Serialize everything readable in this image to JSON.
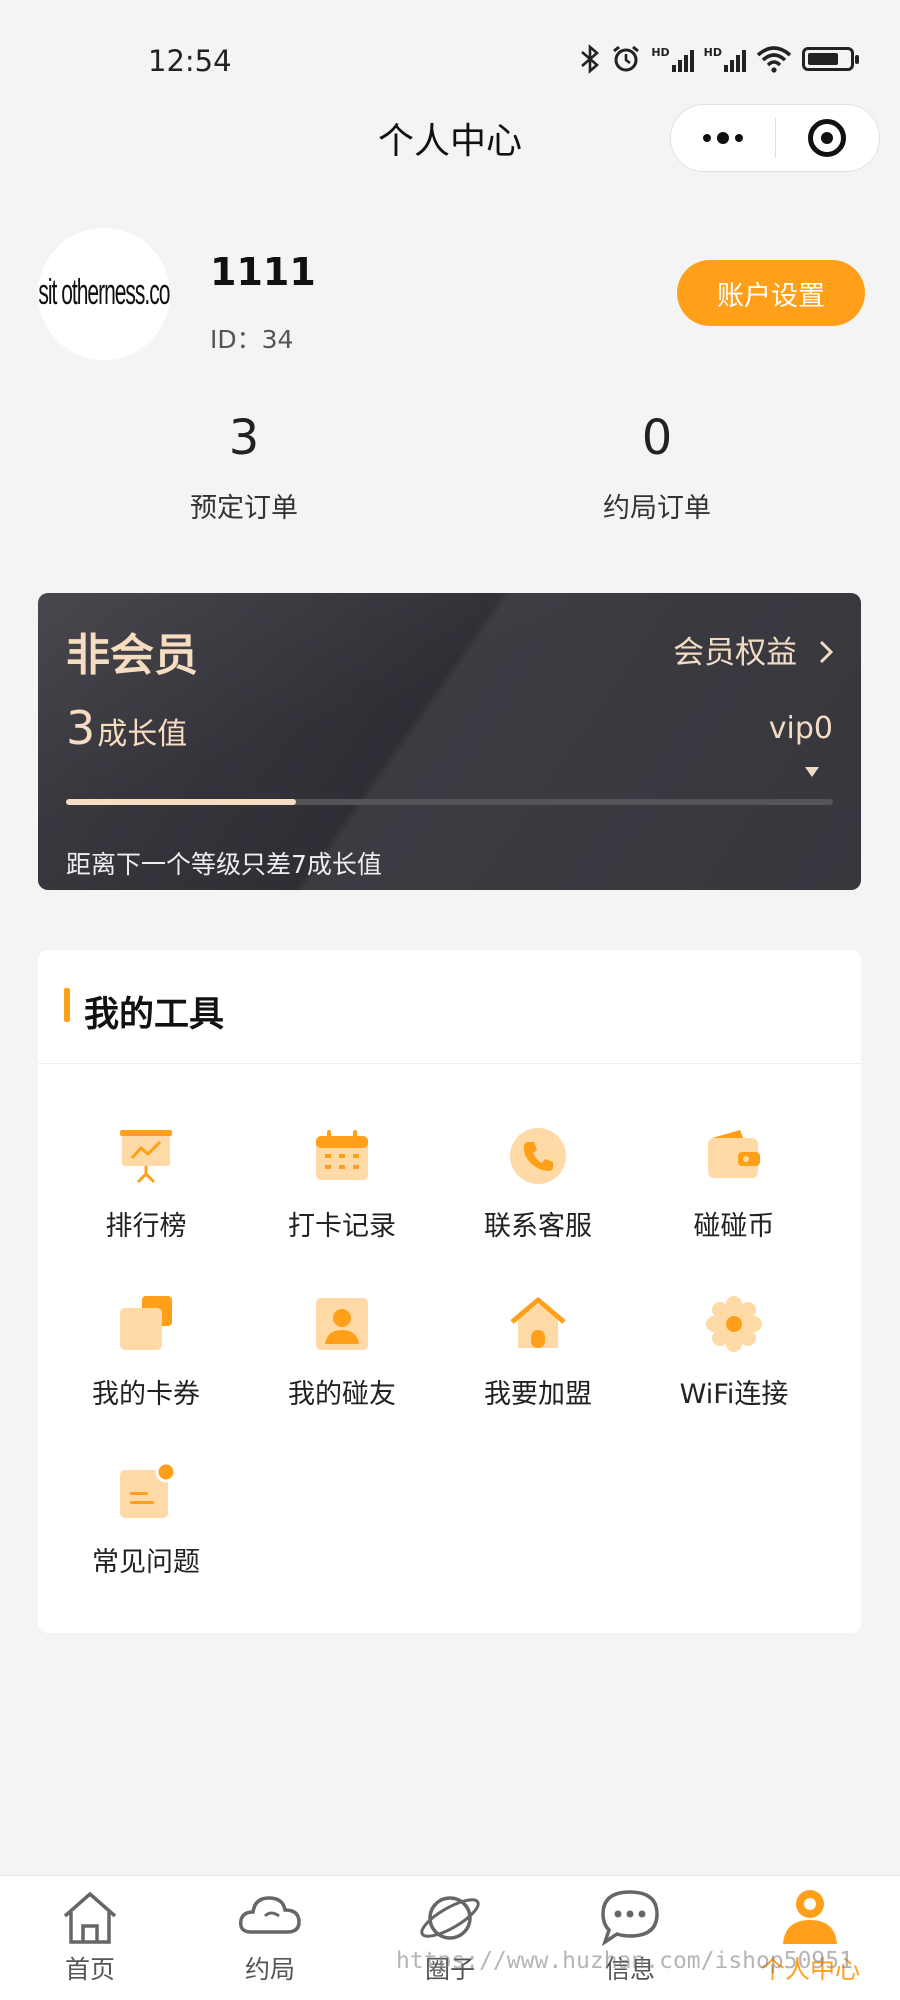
{
  "status_bar": {
    "time": "12:54",
    "hd1": "HD",
    "hd2": "HD"
  },
  "nav": {
    "title": "个人中心"
  },
  "profile": {
    "avatar_text": "Visit otherness.com",
    "username": "1111",
    "id_text": "ID：34",
    "settings_button": "账户设置"
  },
  "stats": [
    {
      "value": "3",
      "label": "预定订单"
    },
    {
      "value": "0",
      "label": "约局订单"
    }
  ],
  "vip": {
    "title": "非会员",
    "rights_link": "会员权益",
    "growth_value": "3",
    "growth_label": "成长值",
    "level": "vip0",
    "progress_fraction": 0.3,
    "note": "距离下一个等级只差7成长值"
  },
  "tools": {
    "title": "我的工具",
    "items": [
      {
        "label": "排行榜",
        "icon": "leaderboard-icon"
      },
      {
        "label": "打卡记录",
        "icon": "calendar-icon"
      },
      {
        "label": "联系客服",
        "icon": "phone-icon"
      },
      {
        "label": "碰碰币",
        "icon": "wallet-icon"
      },
      {
        "label": "我的卡券",
        "icon": "coupon-icon"
      },
      {
        "label": "我的碰友",
        "icon": "friend-icon"
      },
      {
        "label": "我要加盟",
        "icon": "home-icon"
      },
      {
        "label": "WiFi连接",
        "icon": "gear-icon"
      },
      {
        "label": "常见问题",
        "icon": "faq-icon"
      }
    ]
  },
  "tabbar": {
    "items": [
      {
        "label": "首页",
        "icon": "home-tab-icon"
      },
      {
        "label": "约局",
        "icon": "cloud-tab-icon"
      },
      {
        "label": "圈子",
        "icon": "planet-tab-icon"
      },
      {
        "label": "信息",
        "icon": "chat-tab-icon"
      },
      {
        "label": "个人中心",
        "icon": "profile-tab-icon"
      }
    ]
  },
  "watermark": "https://www.huzhan.com/ishop50951",
  "colors": {
    "accent": "#ff9f1a",
    "vip_gold": "#f6dcc0",
    "vip_bg": "#34333a"
  }
}
